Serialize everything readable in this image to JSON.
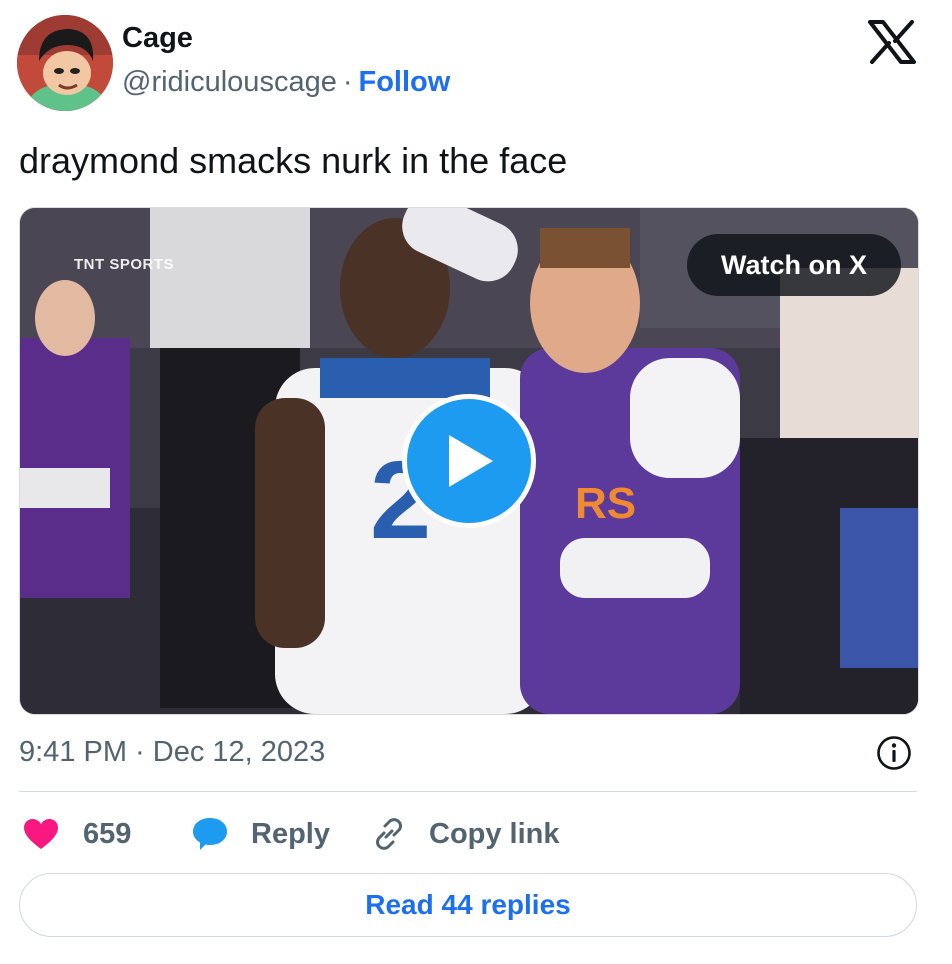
{
  "author": {
    "name": "Cage",
    "handle": "@ridiculouscage",
    "separator": "·",
    "follow_label": "Follow"
  },
  "tweet": {
    "text": "draymond smacks nurk in the face",
    "timestamp": "9:41 PM · Dec 12, 2023"
  },
  "media": {
    "watch_label": "Watch on X",
    "broadcaster_logo": "TNT SPORTS"
  },
  "actions": {
    "likes": "659",
    "reply_label": "Reply",
    "copy_label": "Copy link"
  },
  "footer": {
    "read_replies_label": "Read 44 replies"
  },
  "colors": {
    "accent": "#1d6ff0",
    "play_button": "#1d9bf0",
    "like": "#f91880",
    "text_secondary": "#536471"
  },
  "icons": {
    "brand": "x-logo-icon",
    "play": "play-icon",
    "info": "info-icon",
    "like": "heart-icon",
    "reply": "speech-bubble-icon",
    "copy": "link-icon"
  }
}
